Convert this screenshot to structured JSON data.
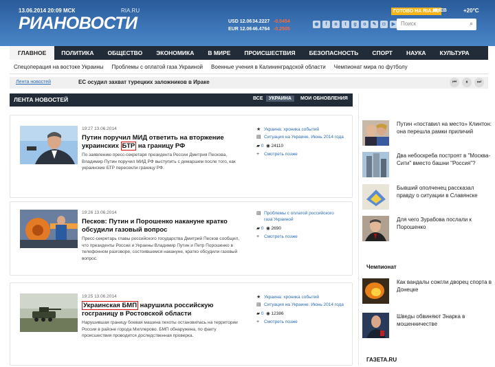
{
  "header": {
    "date": "13.06.2014",
    "time": "20:09 МСК",
    "site": "RIA.RU",
    "logo": "РИАНОВОСТИ",
    "usd_label": "USD",
    "usd_date": "12.06",
    "usd_value": "34.2227",
    "usd_change": "-0.0454",
    "eur_label": "EUR",
    "eur_date": "12.06",
    "eur_value": "46.4764",
    "eur_change": "-0.2505",
    "top_button": "ГОТОВО НА RIA.RU",
    "tv": "ИНЕВ",
    "temperature": "+20°С",
    "search_placeholder": "Поиск"
  },
  "nav": [
    "ГЛАВНОЕ",
    "ПОЛИТИКА",
    "ОБЩЕСТВО",
    "ЭКОНОМИКА",
    "В МИРЕ",
    "ПРОИСШЕСТВИЯ",
    "БЕЗОПАСНОСТЬ",
    "СПОРТ",
    "НАУКА",
    "КУЛЬТУРА"
  ],
  "subnav": [
    "Спецоперация на востоке Украины",
    "Проблемы с оплатой газа Украиной",
    "Военные учения в Калининградской области",
    "Чемпионат мира по футболу"
  ],
  "ticker": {
    "link": "Лента новостей",
    "text": "ЕС осудил захват турецких заложников в Ираке"
  },
  "feed": {
    "title": "ЛЕНТА НОВОСТЕЙ",
    "filters": [
      "ВСЕ",
      "УКРАИНА",
      "МОИ ОБНОВЛЕНИЯ"
    ]
  },
  "news": [
    {
      "time": "19:27 13.06.2014",
      "title_pre": "Путин поручил МИД ответить на вторжение украинских ",
      "title_hl": "БТР",
      "title_post": " на границу РФ",
      "desc": "По заявлению пресс-секретаря президента России Дмитрия Пескова, Владимир Путин поручил МИД РФ выступить с демаршем после того, как украинские БТР пересекли границу РФ.",
      "links": [
        "Украина: хроника событий",
        "Ситуация на Украине. Июнь 2014 года"
      ],
      "comments": "0",
      "views": "24110",
      "later": "Смотреть позже"
    },
    {
      "time": "19:26 13.06.2014",
      "title_pre": "Песков: Путин и Порошенко накануне кратко обсудили газовый вопрос",
      "title_hl": "",
      "title_post": "",
      "desc": "Пресс-секретарь главы российского государства Дмитрий Песков сообщил, что президенты России и Украины Владимир Путин и Петр Порошенко в телефонном разговоре, состоявшемся накануне, кратко обсудили газовый вопрос.",
      "links": [
        "Проблемы с оплатой российского газа Украиной"
      ],
      "comments": "0",
      "views": "2690",
      "later": "Смотреть позже"
    },
    {
      "time": "19:25 13.06.2014",
      "title_pre": "",
      "title_hl": "Украинская БМП",
      "title_post": " нарушила российскую госграницу в Ростовской области",
      "desc": "Нарушившая границу боевая машина пехоты остановилась на территории России в районе города Миллерово. БМП обнаружена, по факту происшествия проводится доследственная проверка.",
      "links": [
        "Украина: хроника событий",
        "Ситуация на Украине. Июнь 2014 года"
      ],
      "comments": "0",
      "views": "12386",
      "later": "Смотреть позже"
    }
  ],
  "right_news": [
    {
      "text": "Путин «поставил на место» Клинтон: она перешла рамки приличий"
    },
    {
      "text": "Два небоскреба построят в \"Москва-Сити\" вместо башни \"Россия\"?"
    },
    {
      "text": "Бывший ополченец рассказал правду о ситуации в Славянске"
    },
    {
      "text": "Для чего Зурабова послали к Порошенко"
    }
  ],
  "right_section_title": "Чемпионат",
  "right_section_news": [
    {
      "text": "Как вандалы сожгли дворец спорта в Донецке"
    },
    {
      "text": "Шведы обвиняют Знарка в мошенничестве"
    }
  ],
  "gazeta": "ГАЗЕТА.RU",
  "colors": {
    "nav_bg": "#222c38",
    "header_bg": "#3d76b8",
    "link": "#2a6bb6",
    "highlight": "#d21010",
    "orange": "#f6b419"
  }
}
